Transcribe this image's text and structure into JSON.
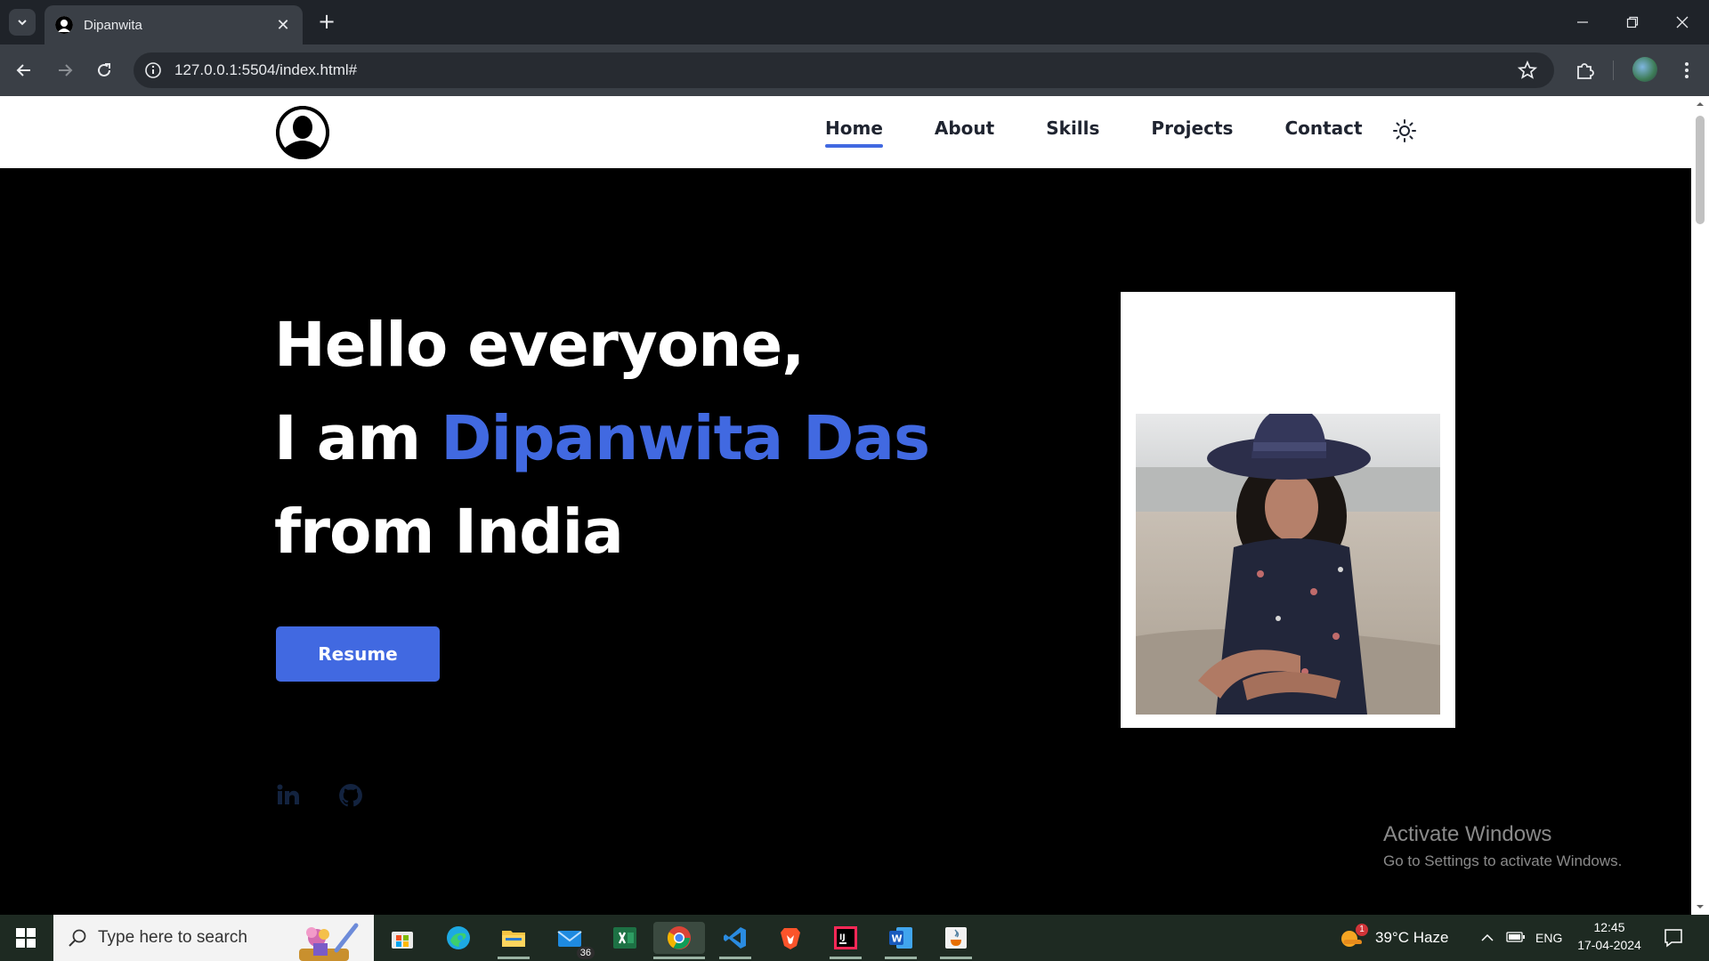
{
  "browser": {
    "tab_title": "Dipanwita",
    "url": "127.0.0.1:5504/index.html#"
  },
  "site": {
    "nav": {
      "items": [
        {
          "label": "Home",
          "active": true
        },
        {
          "label": "About",
          "active": false
        },
        {
          "label": "Skills",
          "active": false
        },
        {
          "label": "Projects",
          "active": false
        },
        {
          "label": "Contact",
          "active": false
        }
      ]
    },
    "hero": {
      "line1": "Hello everyone,",
      "line2_prefix": "I am ",
      "line2_name": "Dipanwita Das",
      "line3": "from India",
      "resume_label": "Resume"
    },
    "colors": {
      "accent": "#4169e1",
      "background": "#000000",
      "header_bg": "#ffffff"
    },
    "social_icons": [
      "linkedin-icon",
      "github-icon"
    ]
  },
  "watermark": {
    "line1": "Activate Windows",
    "line2": "Go to Settings to activate Windows."
  },
  "taskbar": {
    "search_placeholder": "Type here to search",
    "mail_badge": "36",
    "weather": "39°C  Haze",
    "weather_badge": "1",
    "language": "ENG",
    "time": "12:45",
    "date": "17-04-2024"
  }
}
